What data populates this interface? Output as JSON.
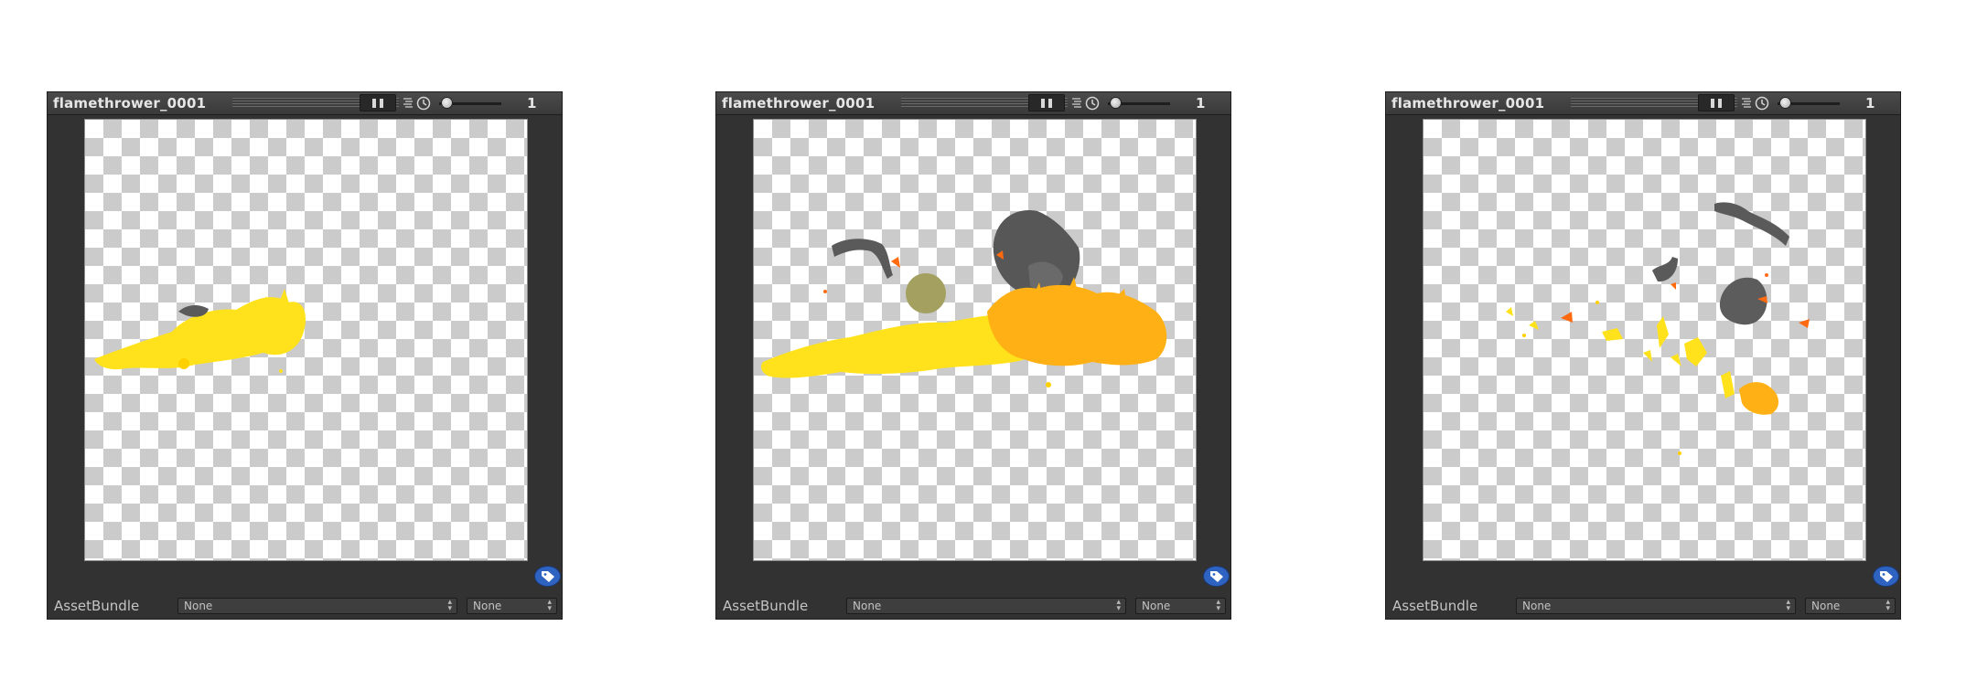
{
  "panels": [
    {
      "title": "flamethrower_0001",
      "frame": "1",
      "assetbundle_label": "AssetBundle",
      "assetbundle_name": "None",
      "assetbundle_variant": "None",
      "icons": {
        "pause": "pause-icon",
        "speed": "speed-clock-icon",
        "tag": "tag-icon"
      }
    },
    {
      "title": "flamethrower_0001",
      "frame": "1",
      "assetbundle_label": "AssetBundle",
      "assetbundle_name": "None",
      "assetbundle_variant": "None",
      "icons": {
        "pause": "pause-icon",
        "speed": "speed-clock-icon",
        "tag": "tag-icon"
      }
    },
    {
      "title": "flamethrower_0001",
      "frame": "1",
      "assetbundle_label": "AssetBundle",
      "assetbundle_name": "None",
      "assetbundle_variant": "None",
      "icons": {
        "pause": "pause-icon",
        "speed": "speed-clock-icon",
        "tag": "tag-icon"
      }
    }
  ],
  "colors": {
    "panel_bg": "#323232",
    "flame_yellow": "#ffe01e",
    "flame_orange": "#ffb014",
    "ember_red": "#ff6a10",
    "smoke_gray": "#5a5a5a",
    "tag_blue": "#2e63c2"
  }
}
